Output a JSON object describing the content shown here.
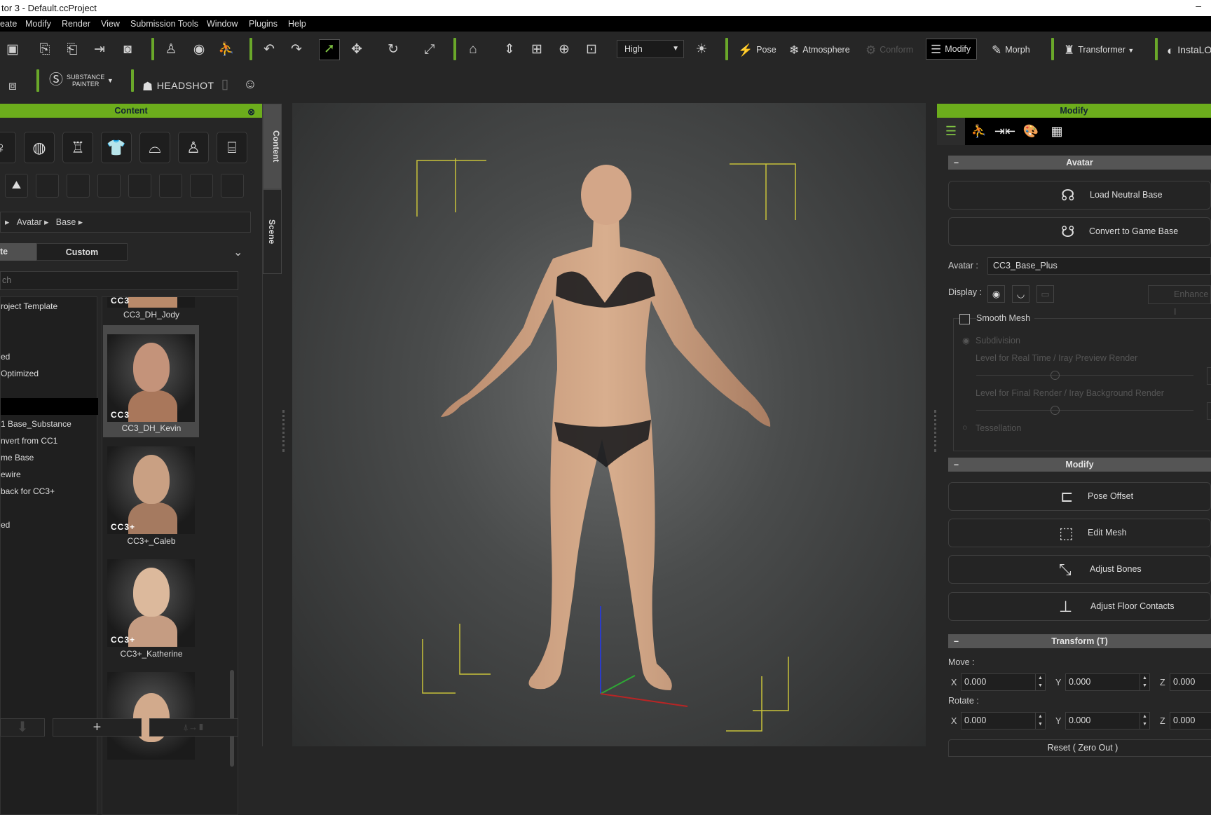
{
  "window": {
    "title": "tor 3 - Default.ccProject",
    "minimize": "–"
  },
  "menu": [
    "eate",
    "Modify",
    "Render",
    "View",
    "Submission Tools",
    "Window",
    "Plugins",
    "Help"
  ],
  "toolbar": {
    "quality": "High",
    "pose": "Pose",
    "atmosphere": "Atmosphere",
    "conform": "Conform",
    "modify": "Modify",
    "morph": "Morph",
    "transformer": "Transformer",
    "instalod": "InstaLO",
    "substance": "SUBSTANCE",
    "painter": "PAINTER",
    "headshot": "HEADSHOT",
    "accent": "#6cad1c"
  },
  "content_panel": {
    "title": "Content",
    "side_tabs": [
      "Content",
      "Scene"
    ],
    "breadcrumb": [
      "Avatar",
      "Base"
    ],
    "tabs": [
      {
        "label": "te",
        "active": true
      },
      {
        "label": "Custom",
        "active": false
      }
    ],
    "search_placeholder": "ch",
    "tree": [
      "roject Template",
      "ed",
      "Optimized",
      "",
      "1 Base_Substance",
      "nvert from CC1",
      "me Base",
      "ewire",
      "back for CC3+",
      "ed"
    ],
    "thumbnails": [
      {
        "label": "CC3_DH_Jody",
        "badge": "CC3"
      },
      {
        "label": "CC3_DH_Kevin",
        "badge": "CC3",
        "selected": true
      },
      {
        "label": "CC3+_Caleb",
        "badge": "CC3+"
      },
      {
        "label": "CC3+_Katherine",
        "badge": "CC3+"
      }
    ],
    "add_button": "+"
  },
  "modify_panel": {
    "title": "Modify",
    "avatar_section": "Avatar",
    "load_neutral": "Load Neutral Base",
    "convert_game": "Convert to Game Base",
    "avatar_label": "Avatar :",
    "avatar_value": "CC3_Base_Plus",
    "display_label": "Display :",
    "enhance": "Enhance I",
    "smooth_mesh": "Smooth Mesh",
    "smooth_checked": false,
    "subdivision": "Subdivision",
    "level_rt": "Level for Real Time / Iray Preview Render",
    "level_final": "Level for Final Render / Iray Background Render",
    "level_value": "1",
    "tessellation": "Tessellation",
    "modify_section": "Modify",
    "pose_offset": "Pose Offset",
    "edit_mesh": "Edit Mesh",
    "adjust_bones": "Adjust Bones",
    "adjust_floor": "Adjust Floor Contacts",
    "transform_section": "Transform  (T)",
    "move_label": "Move :",
    "rotate_label": "Rotate :",
    "axes": [
      "X",
      "Y",
      "Z"
    ],
    "move": [
      "0.000",
      "0.000",
      "0.000"
    ],
    "rotate": [
      "0.000",
      "0.000",
      "0.000"
    ],
    "reset": "Reset ( Zero Out )"
  }
}
